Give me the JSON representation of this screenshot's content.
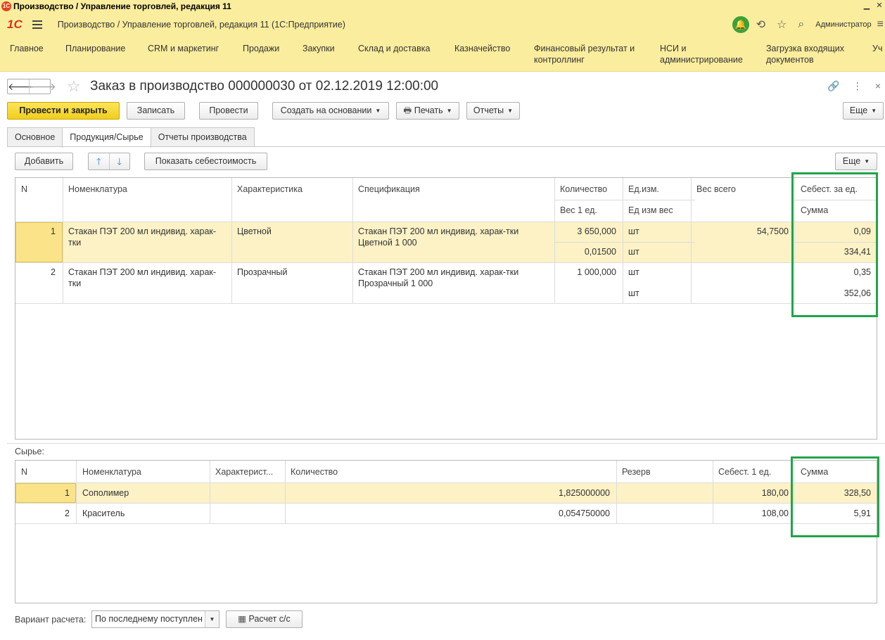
{
  "window": {
    "title": "Производство / Управление торговлей, редакция 11",
    "app_icon": "1С"
  },
  "appbar": {
    "logo": "1С",
    "title": "Производство / Управление торговлей, редакция 11  (1С:Предприятие)",
    "user": "Администратор"
  },
  "sections": [
    "Главное",
    "Планирование",
    "CRM и маркетинг",
    "Продажи",
    "Закупки",
    "Склад и доставка",
    "Казначейство",
    "Финансовый результат и контроллинг",
    "НСИ и администрирование",
    "Загрузка входящих документов",
    "Уч"
  ],
  "form": {
    "title": "Заказ в производство 000000030 от 02.12.2019 12:00:00",
    "toolbar": {
      "post_close": "Провести и закрыть",
      "save": "Записать",
      "post": "Провести",
      "create_based": "Создать на основании",
      "print": "Печать",
      "reports": "Отчеты",
      "more": "Еще"
    },
    "tabs": [
      "Основное",
      "Продукция/Сырье",
      "Отчеты производства"
    ],
    "products_toolbar": {
      "add": "Добавить",
      "show_cost": "Показать себестоимость",
      "more": "Еще"
    },
    "products": {
      "headers": {
        "n": "N",
        "nomenclature": "Номенклатура",
        "characteristic": "Характеристика",
        "specification": "Спецификация",
        "quantity": "Количество",
        "weight1": "Вес 1 ед.",
        "unit": "Ед.изм.",
        "weight_unit": "Ед изм вес",
        "weight_total": "Вес всего",
        "cost_unit": "Себест. за ед.",
        "sum": "Сумма"
      },
      "rows": [
        {
          "n": "1",
          "nomenclature": "Стакан ПЭТ 200 мл индивид. харак-тки",
          "characteristic": "Цветной",
          "specification": "Стакан ПЭТ 200 мл индивид. харак-тки Цветной 1 000",
          "quantity": "3 650,000",
          "weight1": "0,01500",
          "unit": "шт",
          "weight_unit": "шт",
          "weight_total": "54,7500",
          "cost_unit": "0,09",
          "sum": "334,41"
        },
        {
          "n": "2",
          "nomenclature": "Стакан ПЭТ 200 мл индивид. харак-тки",
          "characteristic": "Прозрачный",
          "specification": "Стакан ПЭТ 200 мл индивид. харак-тки Прозрачный 1 000",
          "quantity": "1 000,000",
          "weight1": "",
          "unit": "шт",
          "weight_unit": "шт",
          "weight_total": "",
          "cost_unit": "0,35",
          "sum": "352,06"
        }
      ]
    },
    "materials": {
      "label": "Сырье:",
      "headers": {
        "n": "N",
        "nomenclature": "Номенклатура",
        "characteristic": "Характерист...",
        "quantity": "Количество",
        "reserve": "Резерв",
        "cost_unit": "Себест. 1 ед.",
        "sum": "Сумма"
      },
      "rows": [
        {
          "n": "1",
          "nomenclature": "Сополимер",
          "characteristic": "",
          "quantity": "1,825000000",
          "reserve": "",
          "cost_unit": "180,00",
          "sum": "328,50"
        },
        {
          "n": "2",
          "nomenclature": "Краситель",
          "characteristic": "",
          "quantity": "0,054750000",
          "reserve": "",
          "cost_unit": "108,00",
          "sum": "5,91"
        }
      ]
    },
    "footer": {
      "calc_label": "Вариант расчета:",
      "calc_value": "По последнему поступлен",
      "calc_button": "Расчет с/с"
    }
  },
  "colors": {
    "accent_yellow": "#fbed9e",
    "highlight_green": "#21a44a",
    "selected_row": "#fcf2c6"
  }
}
